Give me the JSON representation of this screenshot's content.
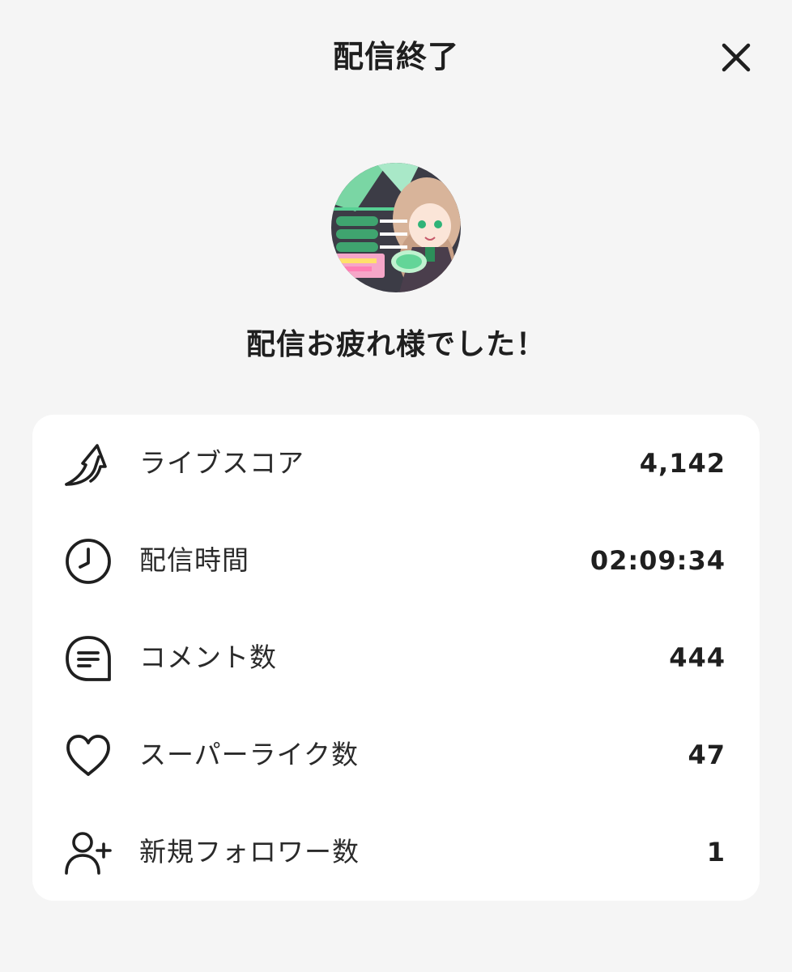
{
  "header": {
    "title": "配信終了",
    "close_icon": "close-icon"
  },
  "profile": {
    "avatar_icon": "streamer-avatar",
    "message": "配信お疲れ様でした！"
  },
  "stats": [
    {
      "icon": "score-arrow-icon",
      "label": "ライブスコア",
      "value": "4,142"
    },
    {
      "icon": "clock-icon",
      "label": "配信時間",
      "value": "02:09:34"
    },
    {
      "icon": "comment-icon",
      "label": "コメント数",
      "value": "444"
    },
    {
      "icon": "heart-icon",
      "label": "スーパーライク数",
      "value": "47"
    },
    {
      "icon": "add-user-icon",
      "label": "新規フォロワー数",
      "value": "1"
    }
  ],
  "colors": {
    "background": "#f5f5f5",
    "card": "#ffffff",
    "text": "#1f1f1f",
    "avatar_accent": "#5ad49a"
  }
}
